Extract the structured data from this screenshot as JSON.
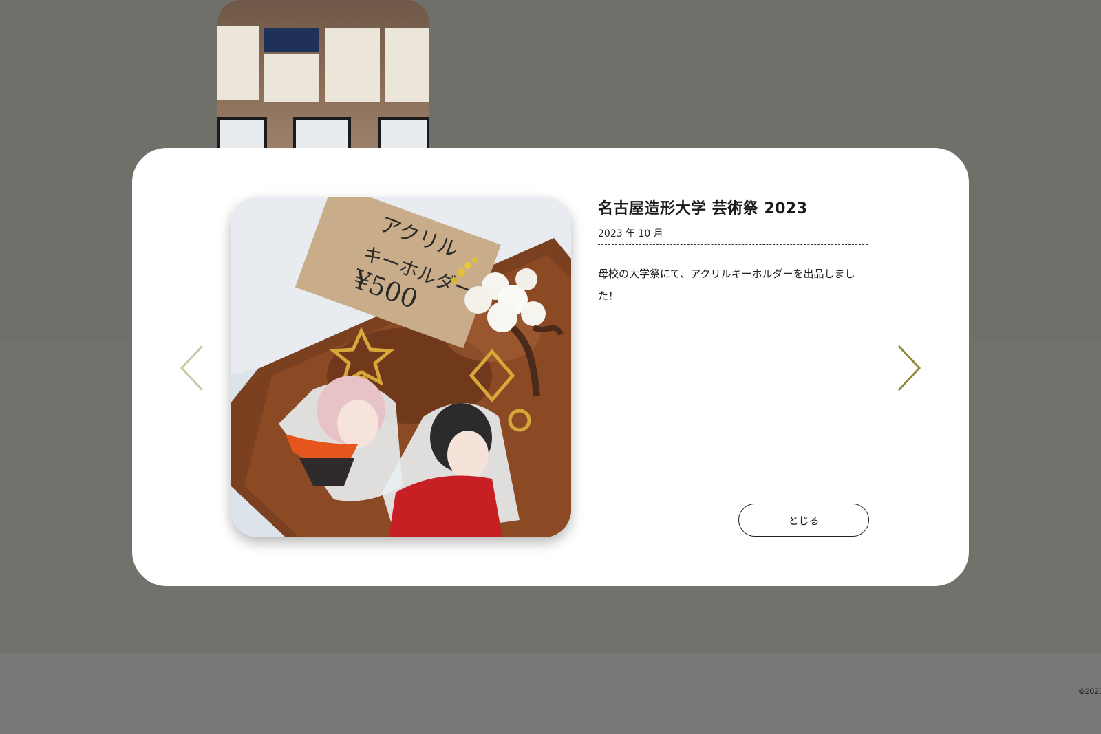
{
  "footer": {
    "copyright": "©2023"
  },
  "modal": {
    "title": "名古屋造形大学 芸術祭 2023",
    "date": "2023 年 10 月",
    "description": "母校の大学祭にて、アクリルキーホルダーを出品しました！",
    "close_label": "とじる",
    "photo": {
      "sign_line1": "アクリル",
      "sign_line2": "キーホルダー",
      "sign_price": "¥500"
    }
  },
  "colors": {
    "overlay": "#70706a",
    "modal_bg": "#ffffff",
    "arrow_prev": "#c9c7a3",
    "arrow_next": "#8f8a3a"
  },
  "icons": {
    "prev": "chevron-left-icon",
    "next": "chevron-right-icon"
  }
}
